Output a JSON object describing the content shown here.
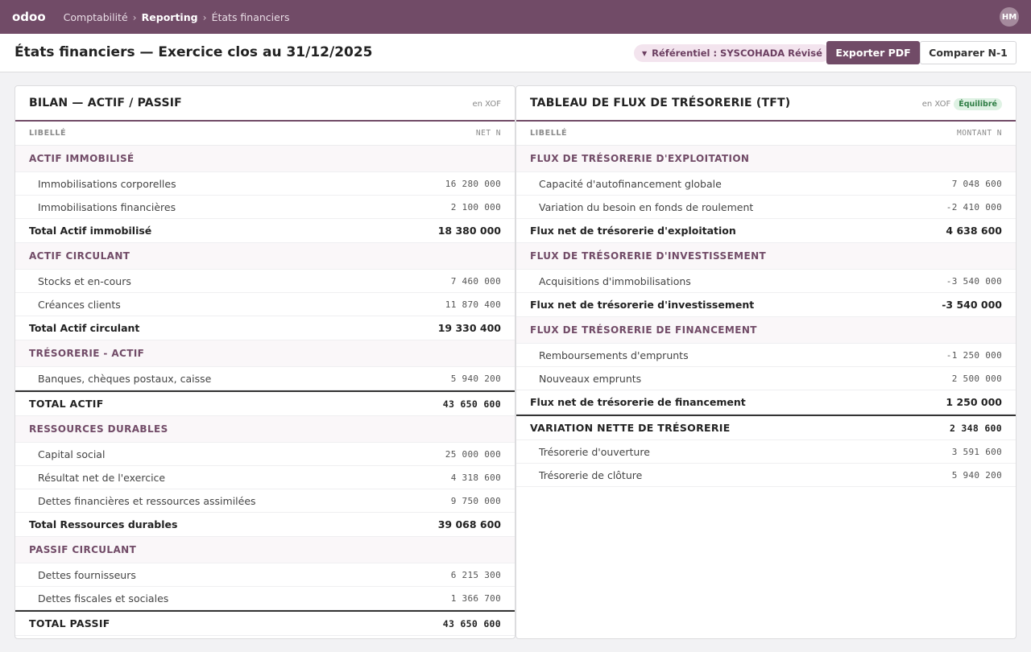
{
  "topbar": {
    "logo": "odoo",
    "breadcrumbs": [
      "Comptabilité",
      "Reporting",
      "États financiers"
    ],
    "separator": "›",
    "user_initials": "HM"
  },
  "header": {
    "title": "États financiers — Exercice clos au 31/12/2025",
    "referential_label": "Référentiel : SYSCOHADA Révisé",
    "export_label": "Exporter PDF",
    "compare_label": "Comparer N-1"
  },
  "colors": {
    "brand": "#714b67",
    "balanced_badge": "#2e7d44"
  },
  "bilan": {
    "title": "BILAN — ACTIF / PASSIF",
    "currency": "en XOF",
    "col_label": "LIBELLÉ",
    "col_value": "NET N",
    "rows": [
      {
        "type": "section",
        "label": "ACTIF IMMOBILISÉ",
        "value": ""
      },
      {
        "type": "item",
        "label": "Immobilisations corporelles",
        "value": "16 280 000"
      },
      {
        "type": "item",
        "label": "Immobilisations financières",
        "value": "2 100 000"
      },
      {
        "type": "total",
        "label": "Total Actif immobilisé",
        "value": "18 380 000"
      },
      {
        "type": "section",
        "label": "ACTIF CIRCULANT",
        "value": ""
      },
      {
        "type": "item",
        "label": "Stocks et en-cours",
        "value": "7 460 000"
      },
      {
        "type": "item",
        "label": "Créances clients",
        "value": "11 870 400"
      },
      {
        "type": "total",
        "label": "Total Actif circulant",
        "value": "19 330 400"
      },
      {
        "type": "section",
        "label": "TRÉSORERIE - ACTIF",
        "value": ""
      },
      {
        "type": "item",
        "label": "Banques, chèques postaux, caisse",
        "value": "5 940 200"
      },
      {
        "type": "grand",
        "label": "TOTAL ACTIF",
        "value": "43 650 600"
      },
      {
        "type": "section",
        "label": "RESSOURCES DURABLES",
        "value": ""
      },
      {
        "type": "item",
        "label": "Capital social",
        "value": "25 000 000"
      },
      {
        "type": "item",
        "label": "Résultat net de l'exercice",
        "value": "4 318 600"
      },
      {
        "type": "item",
        "label": "Dettes financières et ressources assimilées",
        "value": "9 750 000"
      },
      {
        "type": "total",
        "label": "Total Ressources durables",
        "value": "39 068 600"
      },
      {
        "type": "section",
        "label": "PASSIF CIRCULANT",
        "value": ""
      },
      {
        "type": "item",
        "label": "Dettes fournisseurs",
        "value": "6 215 300"
      },
      {
        "type": "item",
        "label": "Dettes fiscales et sociales",
        "value": "1 366 700"
      },
      {
        "type": "grand",
        "label": "TOTAL PASSIF",
        "value": "43 650 600"
      }
    ]
  },
  "tft": {
    "title": "TABLEAU DE FLUX DE TRÉSORERIE (TFT)",
    "currency": "en XOF",
    "badge": "Équilibré",
    "col_label": "LIBELLÉ",
    "col_value": "MONTANT N",
    "rows": [
      {
        "type": "section",
        "label": "FLUX DE TRÉSORERIE D'EXPLOITATION",
        "value": ""
      },
      {
        "type": "item",
        "label": "Capacité d'autofinancement globale",
        "value": "7 048 600"
      },
      {
        "type": "item",
        "label": "Variation du besoin en fonds de roulement",
        "value": "-2 410 000"
      },
      {
        "type": "total",
        "label": "Flux net de trésorerie d'exploitation",
        "value": "4 638 600"
      },
      {
        "type": "section",
        "label": "FLUX DE TRÉSORERIE D'INVESTISSEMENT",
        "value": ""
      },
      {
        "type": "item",
        "label": "Acquisitions d'immobilisations",
        "value": "-3 540 000"
      },
      {
        "type": "total",
        "label": "Flux net de trésorerie d'investissement",
        "value": "-3 540 000"
      },
      {
        "type": "section",
        "label": "FLUX DE TRÉSORERIE DE FINANCEMENT",
        "value": ""
      },
      {
        "type": "item",
        "label": "Remboursements d'emprunts",
        "value": "-1 250 000"
      },
      {
        "type": "item",
        "label": "Nouveaux emprunts",
        "value": "2 500 000"
      },
      {
        "type": "total",
        "label": "Flux net de trésorerie de financement",
        "value": "1 250 000"
      },
      {
        "type": "grand",
        "label": "VARIATION NETTE DE TRÉSORERIE",
        "value": "2 348 600"
      },
      {
        "type": "item",
        "label": "Trésorerie d'ouverture",
        "value": "3 591 600"
      },
      {
        "type": "item",
        "label": "Trésorerie de clôture",
        "value": "5 940 200"
      }
    ]
  }
}
